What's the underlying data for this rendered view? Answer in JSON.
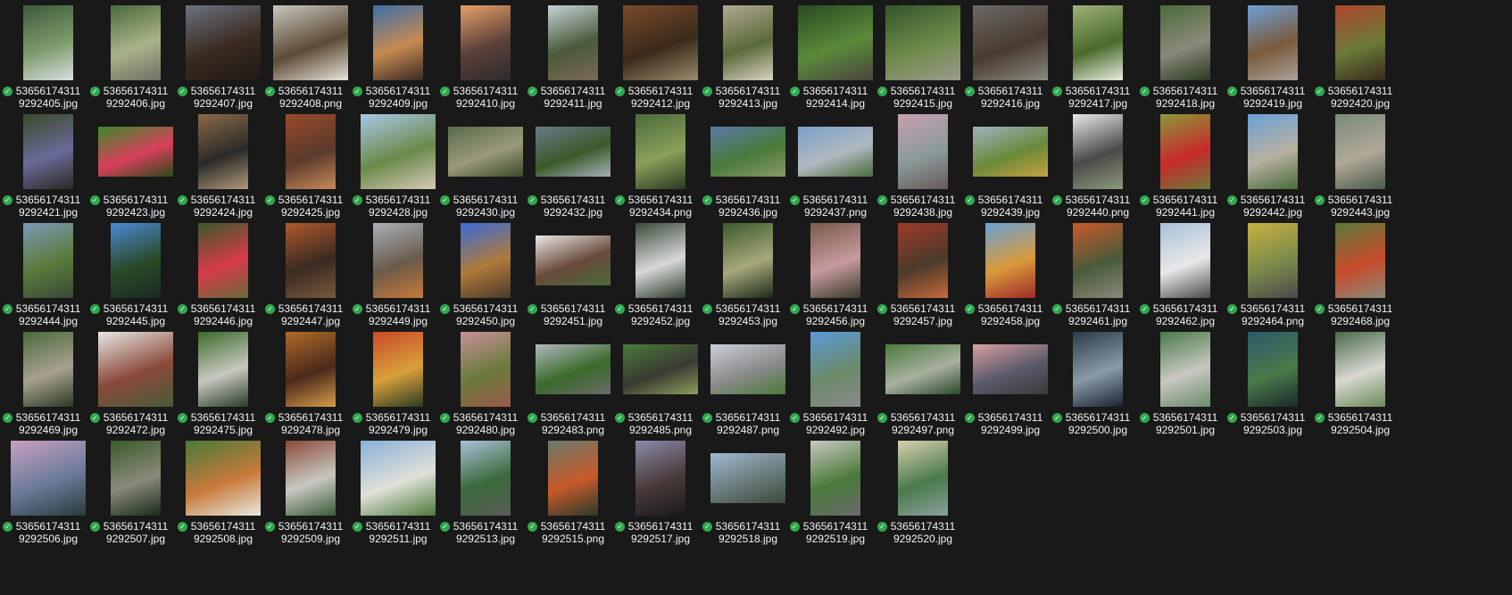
{
  "icons": {
    "status": "sync-check-icon",
    "status_color": "#2fa84f"
  },
  "rows": [
    [
      {
        "l1": "53656174311",
        "l2": "9292405.jpg",
        "o": "p",
        "c": [
          "#3d5a3a",
          "#7d9a6b",
          "#d8dfe0"
        ]
      },
      {
        "l1": "53656174311",
        "l2": "9292406.jpg",
        "o": "p",
        "c": [
          "#4b6a3a",
          "#a9b38a",
          "#6f6f62"
        ]
      },
      {
        "l1": "53656174311",
        "l2": "9292407.jpg",
        "o": "s",
        "c": [
          "#6b7280",
          "#3a2a20",
          "#1f1a16"
        ]
      },
      {
        "l1": "53656174311",
        "l2": "9292408.png",
        "o": "s",
        "c": [
          "#c8c7c0",
          "#5d4a34",
          "#e6e3dc"
        ]
      },
      {
        "l1": "53656174311",
        "l2": "9292409.jpg",
        "o": "p",
        "c": [
          "#3d6fa8",
          "#c68a52",
          "#3b2a22"
        ]
      },
      {
        "l1": "53656174311",
        "l2": "9292410.jpg",
        "o": "p",
        "c": [
          "#e7a067",
          "#5a4039",
          "#2e2a2c"
        ]
      },
      {
        "l1": "53656174311",
        "l2": "9292411.jpg",
        "o": "p",
        "c": [
          "#c5d2d8",
          "#4b5a3a",
          "#7a6a55"
        ]
      },
      {
        "l1": "53656174311",
        "l2": "9292412.jpg",
        "o": "s",
        "c": [
          "#7a4a2a",
          "#3b2a1a",
          "#9a8a6a"
        ]
      },
      {
        "l1": "53656174311",
        "l2": "9292413.jpg",
        "o": "p",
        "c": [
          "#b0a890",
          "#5a6a3a",
          "#d9d2c2"
        ]
      },
      {
        "l1": "53656174311",
        "l2": "9292414.jpg",
        "o": "s",
        "c": [
          "#2a4a22",
          "#5a8a3a",
          "#4a4440"
        ]
      },
      {
        "l1": "53656174311",
        "l2": "9292415.jpg",
        "o": "s",
        "c": [
          "#33552b",
          "#6f8a4a",
          "#9b9a8a"
        ]
      },
      {
        "l1": "53656174311",
        "l2": "9292416.jpg",
        "o": "s",
        "c": [
          "#6a6a64",
          "#4a3a30",
          "#8a8a80"
        ]
      },
      {
        "l1": "53656174311",
        "l2": "9292417.jpg",
        "o": "p",
        "c": [
          "#9fb07a",
          "#4a6a2a",
          "#e8ede2"
        ]
      },
      {
        "l1": "53656174311",
        "l2": "9292418.jpg",
        "o": "p",
        "c": [
          "#4a6a3a",
          "#8a8a7a",
          "#2a3a22"
        ]
      },
      {
        "l1": "53656174311",
        "l2": "9292419.jpg",
        "o": "p",
        "c": [
          "#6f9fd8",
          "#7a5a3a",
          "#a8a29a"
        ]
      },
      {
        "l1": "53656174311",
        "l2": "9292420.jpg",
        "o": "p",
        "c": [
          "#b0452a",
          "#6a7a3a",
          "#3a2a1a"
        ]
      }
    ],
    [
      {
        "l1": "53656174311",
        "l2": "9292421.jpg",
        "o": "p",
        "c": [
          "#3a4a28",
          "#6a6a9a",
          "#2a2a22"
        ]
      },
      {
        "l1": "53656174311",
        "l2": "9292423.jpg",
        "o": "w",
        "c": [
          "#3a8a2a",
          "#d8405a",
          "#2a4a1a"
        ]
      },
      {
        "l1": "53656174311",
        "l2": "9292424.jpg",
        "o": "p",
        "c": [
          "#8a6a4a",
          "#2a2a28",
          "#b09a7a"
        ]
      },
      {
        "l1": "53656174311",
        "l2": "9292425.jpg",
        "o": "p",
        "c": [
          "#9a4a2a",
          "#5a3a2a",
          "#c88a5a"
        ]
      },
      {
        "l1": "53656174311",
        "l2": "9292428.jpg",
        "o": "s",
        "c": [
          "#a8c8e8",
          "#6a8a4a",
          "#d8c8b8"
        ]
      },
      {
        "l1": "53656174311",
        "l2": "9292430.jpg",
        "o": "w",
        "c": [
          "#5a6a4a",
          "#9a9a7a",
          "#3a4a2a"
        ]
      },
      {
        "l1": "53656174311",
        "l2": "9292432.jpg",
        "o": "w",
        "c": [
          "#6a7a8a",
          "#3a5a2a",
          "#a8b0b8"
        ]
      },
      {
        "l1": "53656174311",
        "l2": "9292434.png",
        "o": "p",
        "c": [
          "#4a6a3a",
          "#8aa05a",
          "#2a3a22"
        ]
      },
      {
        "l1": "53656174311",
        "l2": "9292436.jpg",
        "o": "w",
        "c": [
          "#5a7aa8",
          "#4a7a3a",
          "#8a9a6a"
        ]
      },
      {
        "l1": "53656174311",
        "l2": "9292437.png",
        "o": "w",
        "c": [
          "#7aa0c8",
          "#b0b8c0",
          "#4a6a3a"
        ]
      },
      {
        "l1": "53656174311",
        "l2": "9292438.jpg",
        "o": "p",
        "c": [
          "#c8a0b0",
          "#8a9a9a",
          "#6a5a5a"
        ]
      },
      {
        "l1": "53656174311",
        "l2": "9292439.jpg",
        "o": "w",
        "c": [
          "#a0b0c0",
          "#6a8a3a",
          "#c8a040"
        ]
      },
      {
        "l1": "53656174311",
        "l2": "9292440.png",
        "o": "p",
        "c": [
          "#e8e8e6",
          "#4a4a48",
          "#8a9a7a"
        ]
      },
      {
        "l1": "53656174311",
        "l2": "9292441.jpg",
        "o": "p",
        "c": [
          "#8a9a3a",
          "#c82a2a",
          "#6a7a3a"
        ]
      },
      {
        "l1": "53656174311",
        "l2": "9292442.jpg",
        "o": "p",
        "c": [
          "#6aa0d8",
          "#b8b0a0",
          "#4a6a3a"
        ]
      },
      {
        "l1": "53656174311",
        "l2": "9292443.jpg",
        "o": "p",
        "c": [
          "#7a8a7a",
          "#b0a898",
          "#4a5a4a"
        ]
      }
    ],
    [
      {
        "l1": "53656174311",
        "l2": "9292444.jpg",
        "o": "p",
        "c": [
          "#7a9ab8",
          "#5a7a3a",
          "#3a4a3a"
        ]
      },
      {
        "l1": "53656174311",
        "l2": "9292445.jpg",
        "o": "p",
        "c": [
          "#4a8ad8",
          "#2a4a2a",
          "#1a2a22"
        ]
      },
      {
        "l1": "53656174311",
        "l2": "9292446.jpg",
        "o": "p",
        "c": [
          "#3a5a2a",
          "#d83a4a",
          "#6a6a3a"
        ]
      },
      {
        "l1": "53656174311",
        "l2": "9292447.jpg",
        "o": "p",
        "c": [
          "#b05a2a",
          "#3a2a22",
          "#7a5a3a"
        ]
      },
      {
        "l1": "53656174311",
        "l2": "9292449.jpg",
        "o": "p",
        "c": [
          "#a8b0b8",
          "#6a5a4a",
          "#c87a3a"
        ]
      },
      {
        "l1": "53656174311",
        "l2": "9292450.jpg",
        "o": "p",
        "c": [
          "#3a6ad8",
          "#b07a3a",
          "#4a3a2a"
        ]
      },
      {
        "l1": "53656174311",
        "l2": "9292451.jpg",
        "o": "w",
        "c": [
          "#e8e8e8",
          "#6a4a3a",
          "#4a6a3a"
        ]
      },
      {
        "l1": "53656174311",
        "l2": "9292452.jpg",
        "o": "p",
        "c": [
          "#3a4a3a",
          "#d8d8d8",
          "#2a3a2a"
        ]
      },
      {
        "l1": "53656174311",
        "l2": "9292453.jpg",
        "o": "p",
        "c": [
          "#3a5a2a",
          "#a8a87a",
          "#1a2a1a"
        ]
      },
      {
        "l1": "53656174311",
        "l2": "9292456.jpg",
        "o": "p",
        "c": [
          "#7a5a4a",
          "#c89aa0",
          "#3a3a2a"
        ]
      },
      {
        "l1": "53656174311",
        "l2": "9292457.jpg",
        "o": "p",
        "c": [
          "#a03a2a",
          "#4a3a2a",
          "#c86a3a"
        ]
      },
      {
        "l1": "53656174311",
        "l2": "9292458.jpg",
        "o": "p",
        "c": [
          "#6aa0d8",
          "#d89a3a",
          "#a02a2a"
        ]
      },
      {
        "l1": "53656174311",
        "l2": "9292461.jpg",
        "o": "p",
        "c": [
          "#c85a2a",
          "#4a5a3a",
          "#8a8a7a"
        ]
      },
      {
        "l1": "53656174311",
        "l2": "9292462.jpg",
        "o": "p",
        "c": [
          "#a8c0d8",
          "#e8e8e8",
          "#4a4a4a"
        ]
      },
      {
        "l1": "53656174311",
        "l2": "9292464.png",
        "o": "p",
        "c": [
          "#c8b040",
          "#7a8a4a",
          "#4a4a4a"
        ]
      },
      {
        "l1": "53656174311",
        "l2": "9292468.jpg",
        "o": "p",
        "c": [
          "#5a7a3a",
          "#c84a2a",
          "#8a8a7a"
        ]
      }
    ],
    [
      {
        "l1": "53656174311",
        "l2": "9292469.jpg",
        "o": "p",
        "c": [
          "#4a6a3a",
          "#a8a090",
          "#2a3a22"
        ]
      },
      {
        "l1": "53656174311",
        "l2": "9292472.jpg",
        "o": "s",
        "c": [
          "#e8e8e6",
          "#8a4a3a",
          "#4a5a3a"
        ]
      },
      {
        "l1": "53656174311",
        "l2": "9292475.jpg",
        "o": "p",
        "c": [
          "#3a6a2a",
          "#c8c8c0",
          "#2a3a2a"
        ]
      },
      {
        "l1": "53656174311",
        "l2": "9292478.jpg",
        "o": "p",
        "c": [
          "#b06a2a",
          "#4a2a1a",
          "#d89a4a"
        ]
      },
      {
        "l1": "53656174311",
        "l2": "9292479.jpg",
        "o": "p",
        "c": [
          "#c84a2a",
          "#d8a03a",
          "#2a3a22"
        ]
      },
      {
        "l1": "53656174311",
        "l2": "9292480.jpg",
        "o": "p",
        "c": [
          "#c8909a",
          "#6a7a3a",
          "#9a5a4a"
        ]
      },
      {
        "l1": "53656174311",
        "l2": "9292483.png",
        "o": "w",
        "c": [
          "#b0b8c0",
          "#3a6a2a",
          "#6a6a6a"
        ]
      },
      {
        "l1": "53656174311",
        "l2": "9292485.png",
        "o": "w",
        "c": [
          "#4a7a3a",
          "#3a3a32",
          "#8aa05a"
        ]
      },
      {
        "l1": "53656174311",
        "l2": "9292487.png",
        "o": "w",
        "c": [
          "#c8d0d8",
          "#8a8a8a",
          "#4a7a3a"
        ]
      },
      {
        "l1": "53656174311",
        "l2": "9292492.jpg",
        "o": "p",
        "c": [
          "#5a9ad8",
          "#6a8a6a",
          "#8a8a8a"
        ]
      },
      {
        "l1": "53656174311",
        "l2": "9292497.png",
        "o": "w",
        "c": [
          "#4a7a3a",
          "#a8b0a0",
          "#2a4a2a"
        ]
      },
      {
        "l1": "53656174311",
        "l2": "9292499.jpg",
        "o": "w",
        "c": [
          "#d8a0a0",
          "#5a5a6a",
          "#3a3a3a"
        ]
      },
      {
        "l1": "53656174311",
        "l2": "9292500.jpg",
        "o": "p",
        "c": [
          "#2a3a4a",
          "#8a9aa8",
          "#1a2230"
        ]
      },
      {
        "l1": "53656174311",
        "l2": "9292501.jpg",
        "o": "p",
        "c": [
          "#4a7a4a",
          "#c8c8c0",
          "#6a8a6a"
        ]
      },
      {
        "l1": "53656174311",
        "l2": "9292503.jpg",
        "o": "p",
        "c": [
          "#2a5a6a",
          "#4a7a4a",
          "#1a2a2a"
        ]
      },
      {
        "l1": "53656174311",
        "l2": "9292504.jpg",
        "o": "p",
        "c": [
          "#4a6a4a",
          "#d8d8d0",
          "#6a8a5a"
        ]
      }
    ],
    [
      {
        "l1": "53656174311",
        "l2": "9292506.jpg",
        "o": "s",
        "c": [
          "#c8a0c0",
          "#6a7a9a",
          "#2a3a3a"
        ]
      },
      {
        "l1": "53656174311",
        "l2": "9292507.jpg",
        "o": "p",
        "c": [
          "#3a5a2a",
          "#8a8a7a",
          "#1a2a1a"
        ]
      },
      {
        "l1": "53656174311",
        "l2": "9292508.jpg",
        "o": "s",
        "c": [
          "#4a7a3a",
          "#c87a3a",
          "#e8e8e0"
        ]
      },
      {
        "l1": "53656174311",
        "l2": "9292509.jpg",
        "o": "p",
        "c": [
          "#8a4a3a",
          "#c8c8c0",
          "#3a5a3a"
        ]
      },
      {
        "l1": "53656174311",
        "l2": "9292511.jpg",
        "o": "s",
        "c": [
          "#8ab0d8",
          "#e0e0d8",
          "#4a7a3a"
        ]
      },
      {
        "l1": "53656174311",
        "l2": "9292513.jpg",
        "o": "p",
        "c": [
          "#a8c0d8",
          "#3a6a3a",
          "#5a5a5a"
        ]
      },
      {
        "l1": "53656174311",
        "l2": "9292515.png",
        "o": "p",
        "c": [
          "#6a7a6a",
          "#c85a2a",
          "#2a3a2a"
        ]
      },
      {
        "l1": "53656174311",
        "l2": "9292517.jpg",
        "o": "p",
        "c": [
          "#8a8aa8",
          "#4a3a3a",
          "#1a1a1a"
        ]
      },
      {
        "l1": "53656174311",
        "l2": "9292518.jpg",
        "o": "w",
        "c": [
          "#a0b8d0",
          "#6a7a7a",
          "#3a4a3a"
        ]
      },
      {
        "l1": "53656174311",
        "l2": "9292519.jpg",
        "o": "p",
        "c": [
          "#c8c8c0",
          "#4a7a3a",
          "#6a6a6a"
        ]
      },
      {
        "l1": "53656174311",
        "l2": "9292520.jpg",
        "o": "p",
        "c": [
          "#d8d0b0",
          "#4a7a4a",
          "#8aa0a0"
        ]
      }
    ]
  ]
}
